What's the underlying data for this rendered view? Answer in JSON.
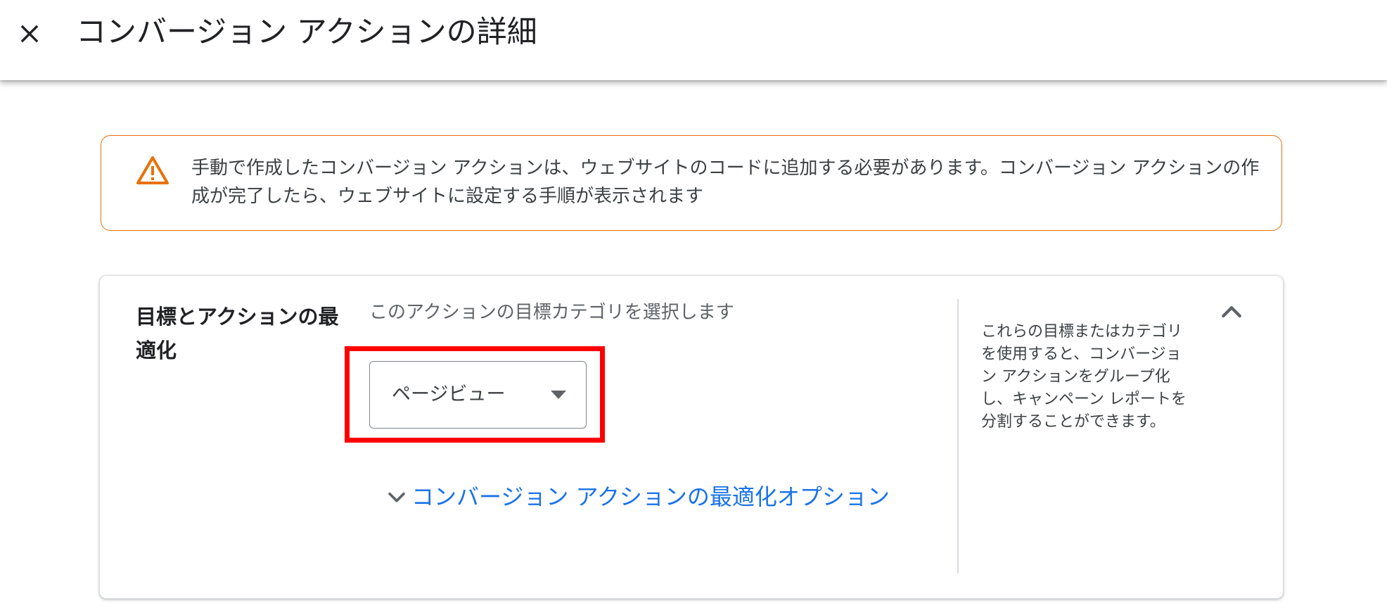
{
  "header": {
    "title": "コンバージョン アクションの詳細",
    "close_icon": "close-icon"
  },
  "warning": {
    "icon": "warning-icon",
    "text": "手動で作成したコンバージョン アクションは、ウェブサイトのコードに追加する必要があります。コンバージョン アクションの作成が完了したら、ウェブサイトに設定する手順が表示されます",
    "border_color": "#e8710a"
  },
  "goal_section": {
    "title": "目標とアクションの最適化",
    "prompt": "このアクションの目標カテゴリを選択します",
    "dropdown": {
      "selected": "ページビュー"
    },
    "optimization_link": "コンバージョン アクションの最適化オプション",
    "help_text": "これらの目標またはカテゴリを使用すると、コンバージョン アクションをグループ化し、キャンペーン レポートを分割することができます。",
    "collapse_icon": "chevron-up-icon"
  },
  "colors": {
    "link": "#1a73e8",
    "highlight": "#ff0000",
    "warning": "#e8710a"
  }
}
